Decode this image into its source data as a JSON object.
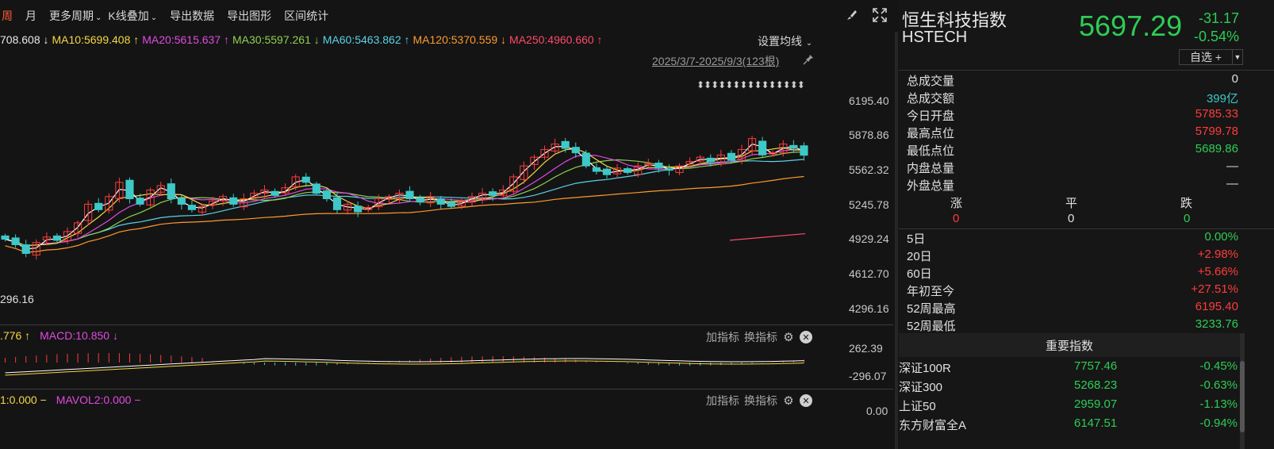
{
  "toolbar": {
    "items": [
      {
        "label": "周",
        "active": true
      },
      {
        "label": "月"
      },
      {
        "label": "更多周期",
        "caret": true
      },
      {
        "label": "K线叠加",
        "caret": true
      },
      {
        "label": "导出数据"
      },
      {
        "label": "导出图形"
      },
      {
        "label": "区间统计"
      }
    ],
    "brush_icon": "brush-icon",
    "fullscreen_icon": "fullscreen-icon"
  },
  "ma_legend": [
    {
      "text": "708.608 ↓",
      "color": "#e8e8e8"
    },
    {
      "text": "MA10:5699.408 ↑",
      "color": "#f5d742"
    },
    {
      "text": "MA20:5615.637 ↑",
      "color": "#e04ae0"
    },
    {
      "text": "MA30:5597.261 ↓",
      "color": "#8fd14f"
    },
    {
      "text": "MA60:5463.862 ↑",
      "color": "#5ad2e6"
    },
    {
      "text": "MA120:5370.559 ↓",
      "color": "#ff9a2e"
    },
    {
      "text": "MA250:4960.660 ↑",
      "color": "#ff4a6a"
    }
  ],
  "ma_settings": "设置均线",
  "date_range": "2025/3/7-2025/9/3(123根)",
  "arrow_marks": "⬍⬍⬍⬍⬍⬍⬍⬍⬍⬍⬍⬍⬍⬍⬍",
  "low_label": "296.16",
  "y_axis": [
    "6195.40",
    "5878.86",
    "5562.32",
    "5245.78",
    "4929.24",
    "4612.70",
    "4296.16"
  ],
  "macd": {
    "legend": [
      {
        "text": ".776 ↑",
        "color": "#f5d742"
      },
      {
        "text": "MACD:10.850 ↓",
        "color": "#e04ae0"
      }
    ],
    "y_top": "262.39",
    "y_bottom": "-296.07",
    "add_label": "加指标",
    "switch_label": "换指标"
  },
  "volume": {
    "legend": [
      {
        "text": "1:0.000 −",
        "color": "#f5d742"
      },
      {
        "text": "MAVOL2:0.000 −",
        "color": "#e04ae0"
      }
    ],
    "y_top": "0.00",
    "add_label": "加指标",
    "switch_label": "换指标"
  },
  "chart_data": {
    "type": "candlestick",
    "period": "weekly",
    "x_range": "2025/3/7-2025/9/3",
    "bars": 123,
    "ylim": [
      4296.16,
      6195.4
    ],
    "y_ticks": [
      6195.4,
      5878.86,
      5562.32,
      5245.78,
      4929.24,
      4612.7,
      4296.16
    ],
    "closes": [
      4930,
      4880,
      4800,
      4900,
      4950,
      4920,
      5000,
      5080,
      5250,
      5200,
      5320,
      5450,
      5300,
      5250,
      5380,
      5420,
      5300,
      5250,
      5200,
      5230,
      5280,
      5320,
      5250,
      5300,
      5350,
      5380,
      5330,
      5400,
      5500,
      5450,
      5350,
      5300,
      5200,
      5250,
      5180,
      5220,
      5300,
      5320,
      5350,
      5300,
      5270,
      5320,
      5250,
      5230,
      5280,
      5320,
      5350,
      5330,
      5380,
      5500,
      5600,
      5680,
      5750,
      5800,
      5760,
      5720,
      5600,
      5550,
      5520,
      5580,
      5540,
      5600,
      5620,
      5580,
      5560,
      5600,
      5640,
      5680,
      5640,
      5700,
      5650,
      5750,
      5850,
      5700,
      5720,
      5800,
      5760,
      5697.29
    ],
    "series": [
      {
        "name": "MA10",
        "value": 5699.408,
        "color": "#f5d742"
      },
      {
        "name": "MA20",
        "value": 5615.637,
        "color": "#e04ae0"
      },
      {
        "name": "MA30",
        "value": 5597.261,
        "color": "#8fd14f"
      },
      {
        "name": "MA60",
        "value": 5463.862,
        "color": "#5ad2e6"
      },
      {
        "name": "MA120",
        "value": 5370.559,
        "color": "#ff9a2e"
      },
      {
        "name": "MA250",
        "value": 4960.66,
        "color": "#ff4a6a"
      }
    ]
  },
  "panel": {
    "name": "恒生科技指数",
    "code": "HSTECH",
    "price": "5697.29",
    "change": "-31.17",
    "change_pct": "-0.54%",
    "watchlist_button": "自选 +",
    "stats": [
      {
        "label": "总成交量",
        "value": "0",
        "cls": "white"
      },
      {
        "label": "总成交额",
        "value": "399亿",
        "cls": "cyan"
      },
      {
        "label": "今日开盘",
        "value": "5785.33",
        "cls": "red"
      },
      {
        "label": "最高点位",
        "value": "5799.78",
        "cls": "red"
      },
      {
        "label": "最低点位",
        "value": "5689.86",
        "cls": "green"
      },
      {
        "label": "内盘总量",
        "value": "—",
        "cls": "white"
      },
      {
        "label": "外盘总量",
        "value": "—",
        "cls": "white"
      }
    ],
    "rise_fall": {
      "rise_label": "涨",
      "flat_label": "平",
      "fall_label": "跌",
      "rise": "0",
      "flat": "0",
      "fall": "0"
    },
    "periods": [
      {
        "label": "5日",
        "value": "0.00%",
        "cls": "green"
      },
      {
        "label": "20日",
        "value": "+2.98%",
        "cls": "red"
      },
      {
        "label": "60日",
        "value": "+5.66%",
        "cls": "red"
      },
      {
        "label": "年初至今",
        "value": "+27.51%",
        "cls": "red"
      },
      {
        "label": "52周最高",
        "value": "6195.40",
        "cls": "red"
      },
      {
        "label": "52周最低",
        "value": "3233.76",
        "cls": "green"
      }
    ],
    "important_title": "重要指数",
    "important": [
      {
        "name": "深证100R",
        "value": "7757.46",
        "pct": "-0.45%"
      },
      {
        "name": "深证300",
        "value": "5268.23",
        "pct": "-0.63%"
      },
      {
        "name": "上证50",
        "value": "2959.07",
        "pct": "-1.13%"
      },
      {
        "name": "东方财富全A",
        "value": "6147.51",
        "pct": "-0.94%"
      }
    ]
  }
}
